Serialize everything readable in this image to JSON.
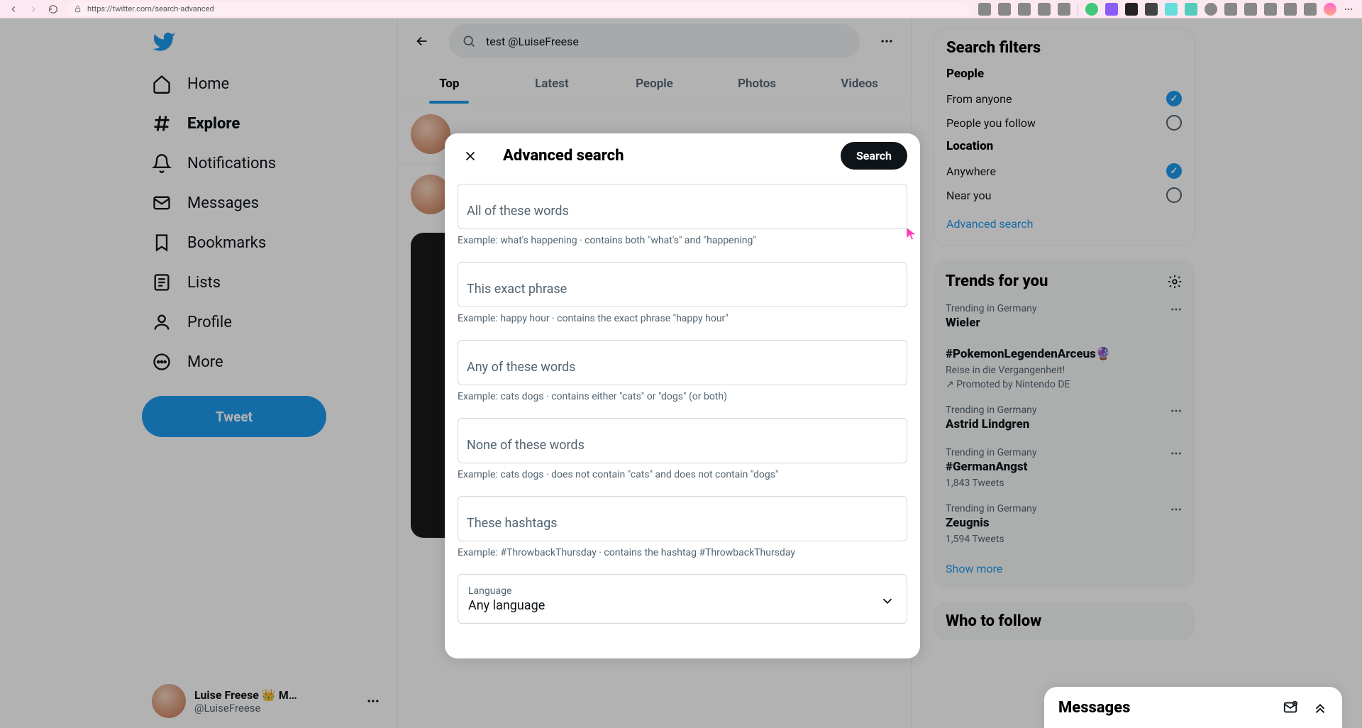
{
  "browser": {
    "url": "https://twitter.com/search-advanced"
  },
  "nav": {
    "home": "Home",
    "explore": "Explore",
    "notifications": "Notifications",
    "messages": "Messages",
    "bookmarks": "Bookmarks",
    "lists": "Lists",
    "profile": "Profile",
    "more": "More",
    "tweet_btn": "Tweet"
  },
  "account": {
    "name": "Luise Freese 👑 M…",
    "handle": "@LuiseFreese"
  },
  "search": {
    "value": "test @LuiseFreese"
  },
  "tabs": {
    "top": "Top",
    "latest": "Latest",
    "people": "People",
    "photos": "Photos",
    "videos": "Videos"
  },
  "modal": {
    "title": "Advanced search",
    "search_btn": "Search",
    "all_words_label": "All of these words",
    "all_words_hint": "Example: what's happening · contains both \"what's\" and \"happening\"",
    "exact_phrase_label": "This exact phrase",
    "exact_phrase_hint": "Example: happy hour · contains the exact phrase \"happy hour\"",
    "any_words_label": "Any of these words",
    "any_words_hint": "Example: cats dogs · contains either \"cats\" or \"dogs\" (or both)",
    "none_words_label": "None of these words",
    "none_words_hint": "Example: cats dogs · does not contain \"cats\" and does not contain \"dogs\"",
    "hashtags_label": "These hashtags",
    "hashtags_hint": "Example: #ThrowbackThursday · contains the hashtag #ThrowbackThursday",
    "language_label": "Language",
    "language_value": "Any language"
  },
  "filters": {
    "title": "Search filters",
    "people_title": "People",
    "from_anyone": "From anyone",
    "people_follow": "People you follow",
    "location_title": "Location",
    "anywhere": "Anywhere",
    "near_you": "Near you",
    "advanced_link": "Advanced search"
  },
  "trends": {
    "title": "Trends for you",
    "items": [
      {
        "context": "Trending in Germany",
        "name": "Wieler",
        "sub": ""
      },
      {
        "context": "",
        "name": "#PokemonLegendenArceus🔮",
        "sub": "Reise in die Vergangenheit!",
        "promoted": "Promoted by Nintendo DE"
      },
      {
        "context": "Trending in Germany",
        "name": "Astrid Lindgren",
        "sub": ""
      },
      {
        "context": "Trending in Germany",
        "name": "#GermanAngst",
        "sub": "1,843 Tweets"
      },
      {
        "context": "Trending in Germany",
        "name": "Zeugnis",
        "sub": "1,594 Tweets"
      }
    ],
    "show_more": "Show more"
  },
  "who_follow": {
    "title": "Who to follow"
  },
  "messages_drawer": {
    "title": "Messages"
  }
}
